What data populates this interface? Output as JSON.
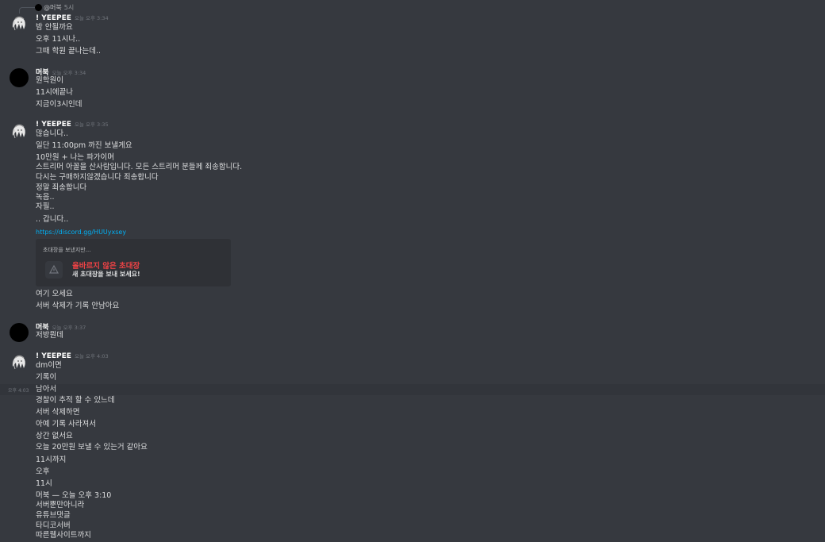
{
  "reply": {
    "name": "@머북",
    "time": "5시"
  },
  "groups": [
    {
      "username": "! YEEPEE",
      "timestamp": "오늘 오후 3:34",
      "lines": [
        "밤 안될까요",
        "오후 11시나..",
        "그때 학원 끝나는데.."
      ]
    },
    {
      "username": "머북",
      "timestamp": "오늘 오후 3:34",
      "lines": [
        "뭔학원이",
        "11시에끝나",
        "지금이3시인데"
      ]
    },
    {
      "username": "! YEEPEE",
      "timestamp": "오늘 오후 3:35",
      "lines": [
        "많습니다..",
        "일단 11:00pm 까진 보낼게요",
        "10만원 + 나는 파가이며",
        "스트리머 아꼴을 산사람입니다. 모든 스트리머 분들께 죄송합니다.",
        "다시는 구매하지않겠습니다 죄송합니다",
        "정말 죄송합니다",
        "녹음..",
        "자필..",
        ".. 갑니다..",
        "https://discord.gg/HUUyxsey"
      ],
      "invite": {
        "header": "초대장을 보냈지만...",
        "title": "올바르지 않은 초대장",
        "subtitle": "새 초대장을 보내 보세요!"
      },
      "after_lines": [
        "여기 오세요",
        "서버 삭제가 기록 안남아요"
      ]
    },
    {
      "username": "머북",
      "timestamp": "오늘 오후 3:37",
      "lines": [
        "저방뭔데"
      ]
    },
    {
      "username": "! YEEPEE",
      "timestamp": "오늘 오후 4:03",
      "hover_time": "오후 4:03",
      "lines": [
        "dm이면",
        "기록이",
        "남아서",
        "경찰이 추적 할 수 있느데",
        "서버 삭제하면",
        "아예 기록 사라져서",
        "상간 없서요",
        "오늘 20만원 보낼 수 있는거 같아요",
        "11시까지",
        "오후",
        "11시",
        "머북 — 오늘 오후 3:10",
        "서버뿐만아니라",
        "유튜브댓글",
        "타디코서버",
        "따른웹사이트까지"
      ]
    }
  ]
}
